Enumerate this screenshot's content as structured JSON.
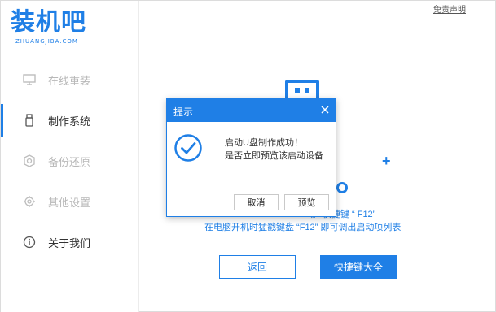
{
  "app": {
    "logo_text": "装机吧",
    "logo_subtext": "ZHUANGJIBA.COM",
    "disclaimer_link": "免责声明",
    "accent_color": "#1f7fe6"
  },
  "sidebar": {
    "items": [
      {
        "label": "在线重装",
        "icon": "monitor-icon",
        "active": false
      },
      {
        "label": "制作系统",
        "icon": "usb-drive-icon",
        "active": true
      },
      {
        "label": "备份还原",
        "icon": "backup-icon",
        "active": false
      },
      {
        "label": "其他设置",
        "icon": "gear-icon",
        "active": false
      },
      {
        "label": "关于我们",
        "icon": "info-icon",
        "active": false
      }
    ]
  },
  "main": {
    "hint_line1": "动U快捷键 “ F12”",
    "hint_line2": "在电脑开机时猛戳键盘 “F12” 即可调出启动项列表",
    "back_button": "返回",
    "shortcut_button": "快捷键大全"
  },
  "dialog": {
    "title": "提示",
    "message_line1": "启动U盘制作成功！",
    "message_line2": "是否立即预览该启动设备",
    "cancel_button": "取消",
    "preview_button": "预览"
  }
}
